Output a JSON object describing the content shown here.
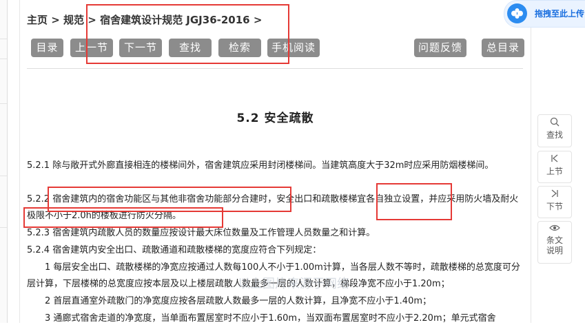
{
  "breadcrumb": {
    "home": "主页",
    "sep1": " > ",
    "category": "规范",
    "sep2": " > ",
    "current": "宿舍建筑设计规范 JGJ36-2016",
    "sep3": " >"
  },
  "toolbar": {
    "contents": "目录",
    "prev": "上一节",
    "next": "下一节",
    "find": "查找",
    "search": "检索",
    "mobile": "手机阅读",
    "feedback": "问题反馈",
    "all_contents": "总目录"
  },
  "section": {
    "title": "5.2 安全疏散",
    "p1": "5.2.1 除与敞开式外廊直接相连的楼梯间外，宿舍建筑应采用封闭楼梯间。当建筑高度大于32m时应采用防烟楼梯间。",
    "p2": "5.2.2 宿舍建筑内的宿舍功能区与其他非宿舍功能部分合建时，安全出口和疏散楼梯宜各自独立设置，并应采用防火墙及耐火极限不小于2.0h的楼板进行防火分隔。",
    "p3": "5.2.3 宿舍建筑内疏散人员的数量应按设计最大床位数量及工作管理人员数量之和计算。",
    "p4": "5.2.4 宿舍建筑内安全出口、疏散通道和疏散楼梯的宽度应符合下列规定：",
    "p5": "1 每层安全出口、疏散楼梯的净宽应按通过人数每100人不小于1.00m计算，当各层人数不等时，疏散楼梯的总宽度可分层计算，下层楼梯的总宽度应按本层及以上楼层疏散人数最多一层的人数计算，梯段净宽不应小于1.20m；",
    "p6": "2 首层直通室外疏散门的净宽度应按各层疏散人数最多一层的人数计算，且净宽不应小于1.40m；",
    "p7": "3 通廊式宿舍走道的净宽度，当单面布置居室时不应小于1.60m，当双面布置居室时不应小于2.20m；单元式宿舍"
  },
  "sidebar": {
    "find": "查找",
    "prev": "上节",
    "next": "下节",
    "explain": "条文说明"
  },
  "sidebar_icons": {
    "find": "search-icon",
    "prev": "step-back-icon",
    "next": "step-forward-icon",
    "explain": "eye-icon"
  },
  "baidu": {
    "label": "拖拽至此上传"
  },
  "watermark": "以上图片来源于网络",
  "colors": {
    "button_bg": "#8c8c8c",
    "highlight_red": "#e53935",
    "baidu_blue": "#2c8cf0"
  }
}
